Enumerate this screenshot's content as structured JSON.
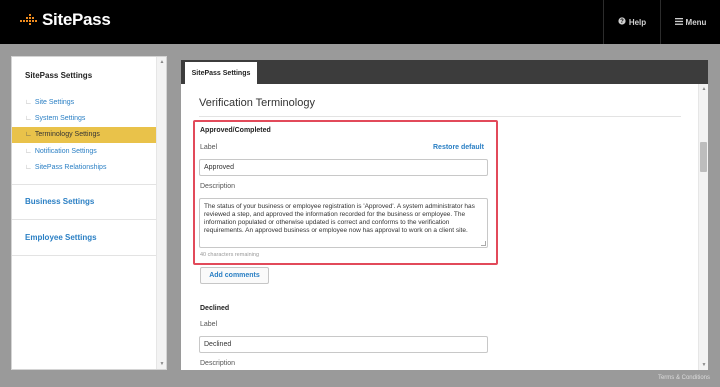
{
  "app": {
    "name": "SitePass"
  },
  "topnav": {
    "help_label": "Help",
    "help_icon": "question-circle-icon",
    "menu_label": "Menu",
    "menu_icon": "hamburger-icon"
  },
  "sidebar": {
    "title": "SitePass Settings",
    "items": [
      {
        "label": "Site Settings",
        "active": false
      },
      {
        "label": "System Settings",
        "active": false
      },
      {
        "label": "Terminology Settings",
        "active": true
      },
      {
        "label": "Notification Settings",
        "active": false
      },
      {
        "label": "SitePass Relationships",
        "active": false
      }
    ],
    "sections": [
      "Business Settings",
      "Employee Settings"
    ]
  },
  "main": {
    "tab_label": "SitePass Settings",
    "heading": "Verification Terminology",
    "approved": {
      "title": "Approved/Completed",
      "label_caption": "Label",
      "restore_label": "Restore default",
      "label_value": "Approved",
      "description_caption": "Description",
      "description_value": "The status of your business or employee registration is 'Approved'. A system administrator has reviewed a step, and approved the information recorded for the business or employee. The information populated or otherwise updated is correct and conforms to the verification requirements. An approved business or employee now has approval to work on a client site.",
      "chars_remaining": "40 characters remaining",
      "add_comments_label": "Add comments"
    },
    "declined": {
      "title": "Declined",
      "label_caption": "Label",
      "label_value": "Declined",
      "description_caption": "Description"
    }
  },
  "footer": {
    "terms_label": "Terms & Conditions"
  },
  "colors": {
    "topbar": "#000000",
    "brand_orange": "#f08c1e",
    "link_blue": "#2a7fc4",
    "active_item": "#e9c24a",
    "highlight_border": "#e24a5a"
  }
}
